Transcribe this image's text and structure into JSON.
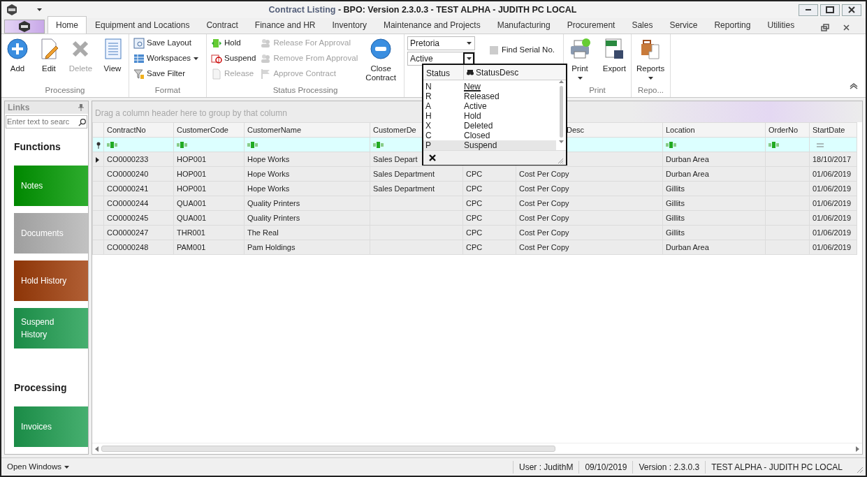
{
  "window": {
    "document": "Contract Listing",
    "app": "- BPO: Version 2.3.0.3 - TEST ALPHA - JUDITH PC LOCAL"
  },
  "tabs": [
    {
      "label": "Home",
      "selected": true
    },
    {
      "label": "Equipment and Locations",
      "selected": false
    },
    {
      "label": "Contract",
      "selected": false
    },
    {
      "label": "Finance and HR",
      "selected": false
    },
    {
      "label": "Inventory",
      "selected": false
    },
    {
      "label": "Maintenance and Projects",
      "selected": false
    },
    {
      "label": "Manufacturing",
      "selected": false
    },
    {
      "label": "Procurement",
      "selected": false
    },
    {
      "label": "Sales",
      "selected": false
    },
    {
      "label": "Service",
      "selected": false
    },
    {
      "label": "Reporting",
      "selected": false
    },
    {
      "label": "Utilities",
      "selected": false
    }
  ],
  "ribbon": {
    "groups": [
      {
        "label": "Processing",
        "columns": [
          [
            {
              "kind": "large",
              "label": "Add",
              "disabled": false
            }
          ],
          [
            {
              "kind": "large",
              "label": "Edit",
              "disabled": false
            }
          ],
          [
            {
              "kind": "large",
              "label": "Delete",
              "disabled": true
            }
          ],
          [
            {
              "kind": "large",
              "label": "View",
              "disabled": false
            }
          ]
        ]
      },
      {
        "label": "Format",
        "columns": [
          [
            {
              "kind": "small",
              "label": "Save Layout",
              "disabled": false
            },
            {
              "kind": "small",
              "label": "Workspaces",
              "disabled": false,
              "dropdown": true
            },
            {
              "kind": "small",
              "label": "Save Filter",
              "disabled": false
            }
          ]
        ]
      },
      {
        "label": "Status Processing",
        "columns": [
          [
            {
              "kind": "small",
              "label": "Hold",
              "disabled": false
            },
            {
              "kind": "small",
              "label": "Suspend",
              "disabled": false
            },
            {
              "kind": "small",
              "label": "Release",
              "disabled": true
            }
          ],
          [
            {
              "kind": "small",
              "label": "Release For Approval",
              "disabled": true
            },
            {
              "kind": "small",
              "label": "Remove From Approval",
              "disabled": true
            },
            {
              "kind": "small",
              "label": "Approve Contract",
              "disabled": true
            }
          ],
          [
            {
              "kind": "large",
              "label": "Close Contract",
              "disabled": false
            }
          ]
        ]
      },
      {
        "columns": [
          [
            {
              "kind": "combo",
              "value": "Pretoria",
              "open": false
            },
            {
              "kind": "combo",
              "value": "Active",
              "open": true
            }
          ],
          [
            {
              "kind": "small",
              "label": "Find Serial No.",
              "disabled": false
            }
          ]
        ]
      },
      {
        "label": "Print",
        "columns": [
          [
            {
              "kind": "large",
              "label": "Print",
              "disabled": false,
              "dropdown": true
            }
          ],
          [
            {
              "kind": "large",
              "label": "Export",
              "disabled": false
            }
          ]
        ]
      },
      {
        "label": "Repo...",
        "columns": [
          [
            {
              "kind": "large",
              "label": "Reports",
              "disabled": false,
              "dropdown": true
            }
          ]
        ]
      }
    ]
  },
  "status_popup": {
    "columns": [
      "Status",
      "StatusDesc"
    ],
    "rows": [
      {
        "code": "N",
        "desc": "New",
        "selected": false,
        "underlined": true
      },
      {
        "code": "R",
        "desc": "Released",
        "selected": false,
        "underlined": false
      },
      {
        "code": "A",
        "desc": "Active",
        "selected": false,
        "underlined": false
      },
      {
        "code": "H",
        "desc": "Hold",
        "selected": false,
        "underlined": false
      },
      {
        "code": "X",
        "desc": "Deleted",
        "selected": false,
        "underlined": false
      },
      {
        "code": "C",
        "desc": "Closed",
        "selected": false,
        "underlined": false
      },
      {
        "code": "P",
        "desc": "Suspend",
        "selected": true,
        "underlined": false
      }
    ]
  },
  "sidebar": {
    "title": "Links",
    "search": {
      "placeholder": "Enter text to searc"
    },
    "sections": [
      {
        "heading": "Functions",
        "tiles": [
          {
            "label": "Notes",
            "color": "#009a00"
          },
          {
            "label": "Documents",
            "color": "#b4b4b4"
          },
          {
            "label": "Hold History",
            "color": "#a03c08"
          },
          {
            "label": "Suspend History",
            "color": "#1e9e50"
          }
        ]
      },
      {
        "heading": "Processing",
        "tiles": [
          {
            "label": "Invoices",
            "color": "#1e9e50"
          }
        ]
      }
    ]
  },
  "grid": {
    "group_hint": "Drag a column header here to group by that column",
    "columns": [
      {
        "label": "ContractNo"
      },
      {
        "label": "CustomerCode"
      },
      {
        "label": "CustomerName"
      },
      {
        "label": "CustomerDe"
      },
      {},
      {
        "label": "Desc"
      },
      {
        "label": "Location"
      },
      {
        "label": "OrderNo"
      },
      {
        "label": "StartDate"
      }
    ],
    "filter_row": [
      {
        "kind": "text"
      },
      {
        "kind": "text"
      },
      {
        "kind": "text"
      },
      {
        "kind": "text"
      },
      {
        "kind": "none"
      },
      {
        "kind": "none"
      },
      {
        "kind": "text"
      },
      {
        "kind": "text"
      },
      {
        "kind": "equals"
      }
    ],
    "rows": [
      {
        "current": true,
        "cells": [
          "CO0000233",
          "HOP001",
          "Hope Works",
          "Sales Depart",
          null,
          null,
          "Durban Area",
          "",
          "18/10/2017"
        ]
      },
      {
        "current": false,
        "cells": [
          "CO0000240",
          "HOP001",
          "Hope Works",
          "Sales Department",
          "CPC",
          "Cost Per Copy",
          "Durban Area",
          "",
          "01/06/2019"
        ]
      },
      {
        "current": false,
        "cells": [
          "CO0000241",
          "HOP001",
          "Hope Works",
          "Sales Department",
          "CPC",
          "Cost Per Copy",
          "Gillits",
          "",
          "01/06/2019"
        ]
      },
      {
        "current": false,
        "cells": [
          "CO0000244",
          "QUA001",
          "Quality Printers",
          "",
          "CPC",
          "Cost Per Copy",
          "Gillits",
          "",
          "01/06/2019"
        ]
      },
      {
        "current": false,
        "cells": [
          "CO0000245",
          "QUA001",
          "Quality Printers",
          "",
          "CPC",
          "Cost Per Copy",
          "Gillits",
          "",
          "01/06/2019"
        ]
      },
      {
        "current": false,
        "cells": [
          "CO0000247",
          "THR001",
          "The Real",
          "",
          "CPC",
          "Cost Per Copy",
          "Gillits",
          "",
          "01/06/2019"
        ]
      },
      {
        "current": false,
        "cells": [
          "CO0000248",
          "PAM001",
          "Pam Holdings",
          "",
          "CPC",
          "Cost Per Copy",
          "Durban Area",
          "",
          "01/06/2019"
        ]
      }
    ]
  },
  "status_bar": {
    "open_windows": "Open Windows",
    "fields": [
      "User : JudithM",
      "09/10/2019",
      "Version : 2.3.0.3",
      "TEST ALPHA - JUDITH PC LOCAL"
    ]
  }
}
